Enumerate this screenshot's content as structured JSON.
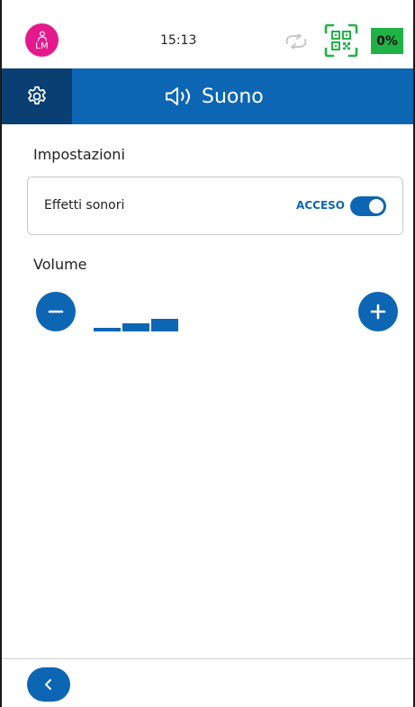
{
  "status_bar": {
    "avatar_initials": "LM",
    "clock": "15:13",
    "battery_label": "0%",
    "colors": {
      "avatar": "#e6198c",
      "qr": "#1fb346",
      "battery": "#1fb346",
      "sync_icon": "#c8c8c8"
    },
    "icons": [
      "user-icon",
      "sync-icon",
      "qr-code-icon"
    ]
  },
  "header": {
    "title": "Suono",
    "icons": [
      "settings-gear-icon",
      "speaker-icon"
    ],
    "colors": {
      "bar": "#0d66b3",
      "settings_button": "#0a3f73"
    }
  },
  "settings_section": {
    "title": "Impostazioni",
    "sound_effects": {
      "label": "Effetti sonori",
      "state_label": "ACCESO",
      "enabled": true
    }
  },
  "volume_section": {
    "title": "Volume",
    "level": 3,
    "max_level": 8,
    "icons": [
      "minus-icon",
      "plus-icon"
    ]
  },
  "footer": {
    "icons": [
      "chevron-left-icon"
    ]
  },
  "theme": {
    "accent": "#0d66b3"
  }
}
